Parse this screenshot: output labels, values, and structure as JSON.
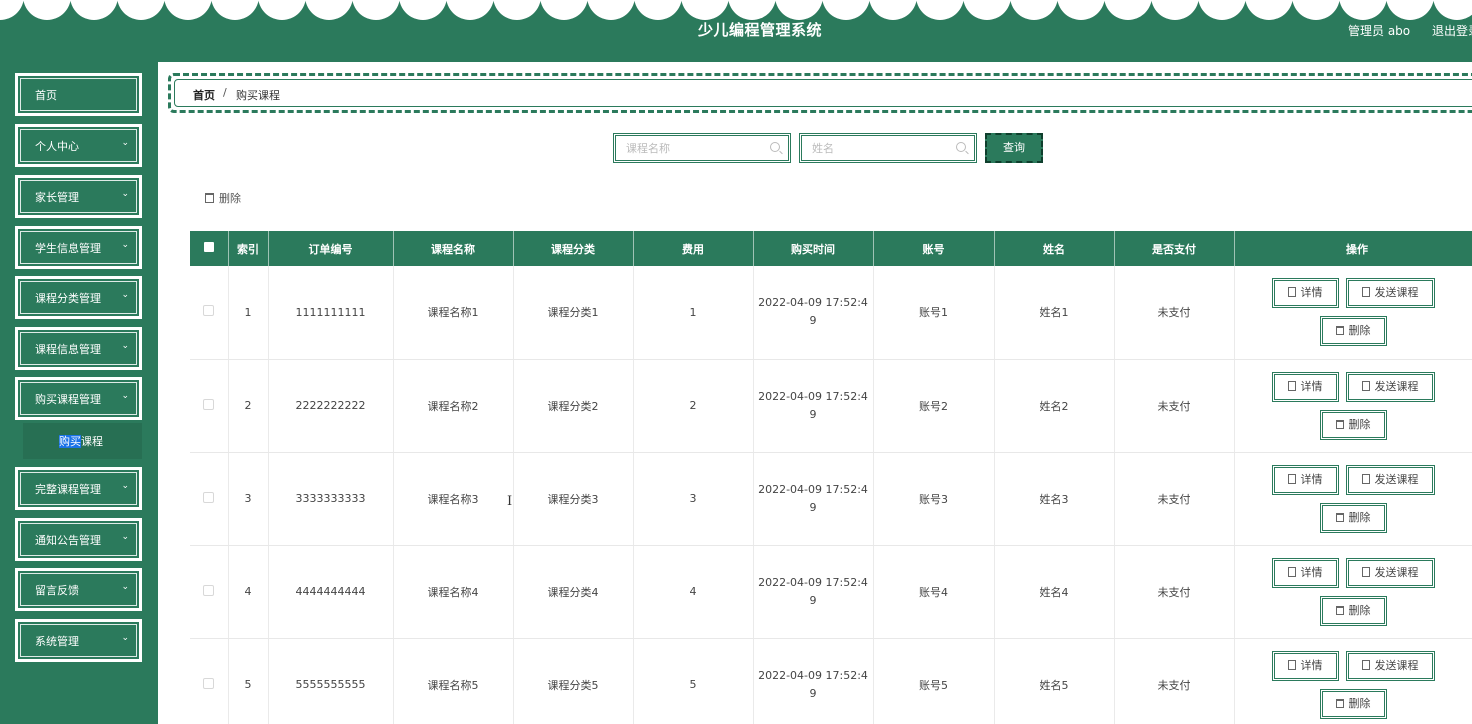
{
  "header": {
    "title": "少儿编程管理系统",
    "user": "管理员 abo",
    "logout": "退出登录"
  },
  "sidebar": {
    "items": [
      {
        "label": "首页"
      },
      {
        "label": "个人中心"
      },
      {
        "label": "家长管理"
      },
      {
        "label": "学生信息管理"
      },
      {
        "label": "课程分类管理"
      },
      {
        "label": "课程信息管理"
      },
      {
        "label": "购买课程管理"
      },
      {
        "label": "完整课程管理"
      },
      {
        "label": "通知公告管理"
      },
      {
        "label": "留言反馈"
      },
      {
        "label": "系统管理"
      }
    ],
    "submenu": {
      "label_selected": "购买",
      "label_rest": "课程"
    }
  },
  "breadcrumb": {
    "home": "首页",
    "sep": "/",
    "current": "购买课程"
  },
  "search": {
    "course_placeholder": "课程名称",
    "name_placeholder": "姓名",
    "button": "查询"
  },
  "bulk_delete": "删除",
  "table": {
    "headers": [
      "索引",
      "订单编号",
      "课程名称",
      "课程分类",
      "费用",
      "购买时间",
      "账号",
      "姓名",
      "是否支付",
      "操作"
    ],
    "rows": [
      {
        "index": "1",
        "order": "1111111111",
        "course": "课程名称1",
        "category": "课程分类1",
        "fee": "1",
        "time_a": "2022-04-09 17:52:4",
        "time_b": "9",
        "account": "账号1",
        "name": "姓名1",
        "paid": "未支付"
      },
      {
        "index": "2",
        "order": "2222222222",
        "course": "课程名称2",
        "category": "课程分类2",
        "fee": "2",
        "time_a": "2022-04-09 17:52:4",
        "time_b": "9",
        "account": "账号2",
        "name": "姓名2",
        "paid": "未支付"
      },
      {
        "index": "3",
        "order": "3333333333",
        "course": "课程名称3",
        "category": "课程分类3",
        "fee": "3",
        "time_a": "2022-04-09 17:52:4",
        "time_b": "9",
        "account": "账号3",
        "name": "姓名3",
        "paid": "未支付"
      },
      {
        "index": "4",
        "order": "4444444444",
        "course": "课程名称4",
        "category": "课程分类4",
        "fee": "4",
        "time_a": "2022-04-09 17:52:4",
        "time_b": "9",
        "account": "账号4",
        "name": "姓名4",
        "paid": "未支付"
      },
      {
        "index": "5",
        "order": "5555555555",
        "course": "课程名称5",
        "category": "课程分类5",
        "fee": "5",
        "time_a": "2022-04-09 17:52:4",
        "time_b": "9",
        "account": "账号5",
        "name": "姓名5",
        "paid": "未支付"
      }
    ],
    "actions": {
      "detail": "详情",
      "send": "发送课程",
      "delete": "删除"
    }
  },
  "colors": {
    "primary": "#2b7a5c",
    "selection": "#1a73e8"
  },
  "icons": [
    "search-icon",
    "trash-icon",
    "document-icon",
    "chevron-down-icon"
  ]
}
